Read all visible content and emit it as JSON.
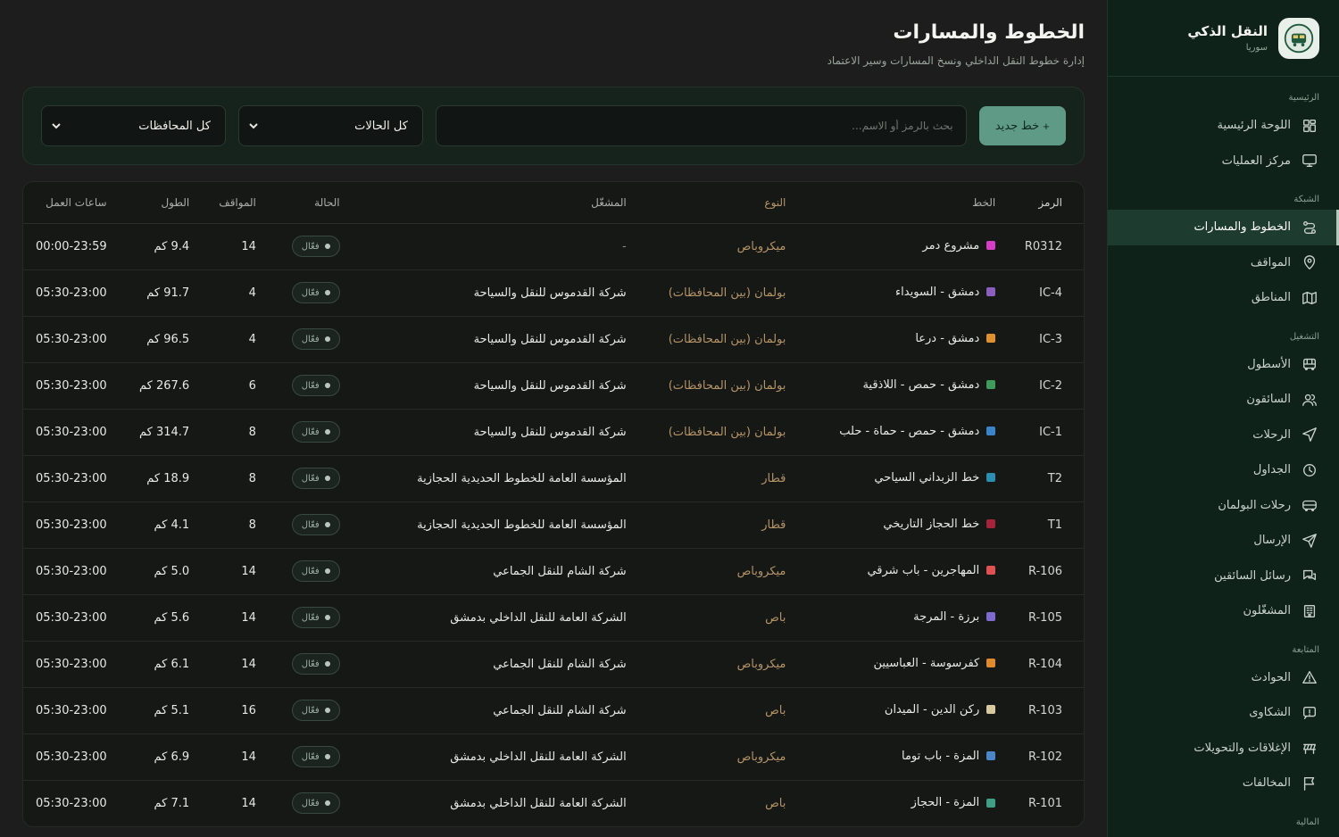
{
  "brand": {
    "title": "النقل الذكي",
    "subtitle": "سوريا"
  },
  "sidebar": {
    "sections": [
      {
        "title": "الرئيسية",
        "items": [
          {
            "label": "اللوحة الرئيسية",
            "icon": "grid-icon"
          },
          {
            "label": "مركز العمليات",
            "icon": "monitor-icon"
          }
        ]
      },
      {
        "title": "الشبكة",
        "items": [
          {
            "label": "الخطوط والمسارات",
            "icon": "route-icon",
            "active": true
          },
          {
            "label": "المواقف",
            "icon": "map-pin-icon"
          },
          {
            "label": "المناطق",
            "icon": "map-icon"
          }
        ]
      },
      {
        "title": "التشغيل",
        "items": [
          {
            "label": "الأسطول",
            "icon": "bus-icon"
          },
          {
            "label": "السائقون",
            "icon": "users-icon"
          },
          {
            "label": "الرحلات",
            "icon": "navigation-icon"
          },
          {
            "label": "الجداول",
            "icon": "clock-icon"
          },
          {
            "label": "رحلات البولمان",
            "icon": "coach-icon"
          },
          {
            "label": "الإرسال",
            "icon": "send-icon"
          },
          {
            "label": "رسائل السائقين",
            "icon": "chat-icon"
          },
          {
            "label": "المشغّلون",
            "icon": "building-icon"
          }
        ]
      },
      {
        "title": "المتابعة",
        "items": [
          {
            "label": "الحوادث",
            "icon": "alert-icon"
          },
          {
            "label": "الشكاوى",
            "icon": "complaint-icon"
          },
          {
            "label": "الإغلاقات والتحويلات",
            "icon": "closure-icon"
          },
          {
            "label": "المخالفات",
            "icon": "flag-icon"
          }
        ]
      },
      {
        "title": "المالية",
        "items": []
      }
    ]
  },
  "page": {
    "title": "الخطوط والمسارات",
    "subtitle": "إدارة خطوط النقل الداخلي ونسخ المسارات وسير الاعتماد"
  },
  "filters": {
    "new_button": "خط جديد",
    "new_button_plus": "+",
    "search_placeholder": "بحث بالرمز أو الاسم...",
    "status_select": "كل الحالات",
    "governorate_select": "كل المحافظات"
  },
  "table": {
    "headers": {
      "code": "الرمز",
      "line": "الخط",
      "type": "النوع",
      "operator": "المشغّل",
      "status": "الحالة",
      "stops": "المواقف",
      "length": "الطول",
      "hours": "ساعات العمل"
    },
    "rows": [
      {
        "code": "R0312",
        "line": "مشروع دمر",
        "color": "#d63ec8",
        "type": "ميكروباص",
        "operator": "-",
        "status": "فعّال",
        "stops": "14",
        "length": "9.4 كم",
        "hours": "00:00-23:59"
      },
      {
        "code": "IC-4",
        "line": "دمشق - السويداء",
        "color": "#8b5fbf",
        "type": "بولمان (بين المحافظات)",
        "operator": "شركة القدموس للنقل والسياحة",
        "status": "فعّال",
        "stops": "4",
        "length": "91.7 كم",
        "hours": "05:30-23:00"
      },
      {
        "code": "IC-3",
        "line": "دمشق - درعا",
        "color": "#e0902f",
        "type": "بولمان (بين المحافظات)",
        "operator": "شركة القدموس للنقل والسياحة",
        "status": "فعّال",
        "stops": "4",
        "length": "96.5 كم",
        "hours": "05:30-23:00"
      },
      {
        "code": "IC-2",
        "line": "دمشق - حمص - اللاذقية",
        "color": "#3e9b5a",
        "type": "بولمان (بين المحافظات)",
        "operator": "شركة القدموس للنقل والسياحة",
        "status": "فعّال",
        "stops": "6",
        "length": "267.6 كم",
        "hours": "05:30-23:00"
      },
      {
        "code": "IC-1",
        "line": "دمشق - حمص - حماة - حلب",
        "color": "#3a84c9",
        "type": "بولمان (بين المحافظات)",
        "operator": "شركة القدموس للنقل والسياحة",
        "status": "فعّال",
        "stops": "8",
        "length": "314.7 كم",
        "hours": "05:30-23:00"
      },
      {
        "code": "T2",
        "line": "خط الزبداني السياحي",
        "color": "#2a8fb0",
        "type": "قطار",
        "operator": "المؤسسة العامة للخطوط الحديدية الحجازية",
        "status": "فعّال",
        "stops": "8",
        "length": "18.9 كم",
        "hours": "05:30-23:00"
      },
      {
        "code": "T1",
        "line": "خط الحجاز التاريخي",
        "color": "#a5243a",
        "type": "قطار",
        "operator": "المؤسسة العامة للخطوط الحديدية الحجازية",
        "status": "فعّال",
        "stops": "8",
        "length": "4.1 كم",
        "hours": "05:30-23:00"
      },
      {
        "code": "R-106",
        "line": "المهاجرين - باب شرقي",
        "color": "#e05252",
        "type": "ميكروباص",
        "operator": "شركة الشام للنقل الجماعي",
        "status": "فعّال",
        "stops": "14",
        "length": "5.0 كم",
        "hours": "05:30-23:00"
      },
      {
        "code": "R-105",
        "line": "برزة - المرجة",
        "color": "#7f6bd0",
        "type": "باص",
        "operator": "الشركة العامة للنقل الداخلي بدمشق",
        "status": "فعّال",
        "stops": "14",
        "length": "5.6 كم",
        "hours": "05:30-23:00"
      },
      {
        "code": "R-104",
        "line": "كفرسوسة - العباسيين",
        "color": "#e08a2c",
        "type": "ميكروباص",
        "operator": "شركة الشام للنقل الجماعي",
        "status": "فعّال",
        "stops": "14",
        "length": "6.1 كم",
        "hours": "05:30-23:00"
      },
      {
        "code": "R-103",
        "line": "ركن الدين - الميدان",
        "color": "#d8c9a0",
        "type": "باص",
        "operator": "شركة الشام للنقل الجماعي",
        "status": "فعّال",
        "stops": "16",
        "length": "5.1 كم",
        "hours": "05:30-23:00"
      },
      {
        "code": "R-102",
        "line": "المزة - باب توما",
        "color": "#4a86c8",
        "type": "ميكروباص",
        "operator": "الشركة العامة للنقل الداخلي بدمشق",
        "status": "فعّال",
        "stops": "14",
        "length": "6.9 كم",
        "hours": "05:30-23:00"
      },
      {
        "code": "R-101",
        "line": "المزة - الحجاز",
        "color": "#3f9e86",
        "type": "باص",
        "operator": "الشركة العامة للنقل الداخلي بدمشق",
        "status": "فعّال",
        "stops": "14",
        "length": "7.1 كم",
        "hours": "05:30-23:00"
      }
    ]
  }
}
